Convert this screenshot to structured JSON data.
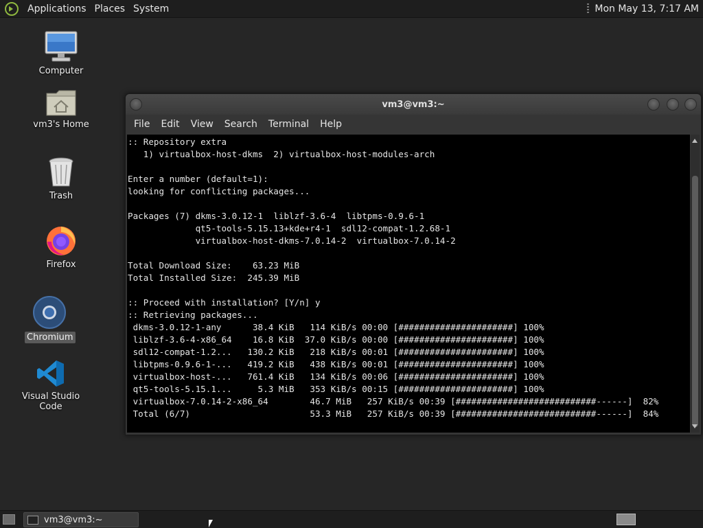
{
  "top_panel": {
    "menus": [
      "Applications",
      "Places",
      "System"
    ],
    "clock": "Mon May 13,  7:17 AM"
  },
  "desktop": {
    "icons": [
      {
        "label": "Computer",
        "icon": "computer-monitor-icon"
      },
      {
        "label": "vm3's Home",
        "icon": "home-folder-icon"
      },
      {
        "label": "Trash",
        "icon": "trash-icon"
      },
      {
        "label": "Firefox",
        "icon": "firefox-icon"
      },
      {
        "label": "Chromium",
        "icon": "chromium-icon",
        "selected": true
      },
      {
        "label": "Visual Studio Code",
        "icon": "vscode-icon"
      }
    ]
  },
  "window": {
    "title": "vm3@vm3:~",
    "menu": [
      "File",
      "Edit",
      "View",
      "Search",
      "Terminal",
      "Help"
    ],
    "terminal_lines": [
      ":: Repository extra",
      "   1) virtualbox-host-dkms  2) virtualbox-host-modules-arch",
      "",
      "Enter a number (default=1):",
      "looking for conflicting packages...",
      "",
      "Packages (7) dkms-3.0.12-1  liblzf-3.6-4  libtpms-0.9.6-1",
      "             qt5-tools-5.15.13+kde+r4-1  sdl12-compat-1.2.68-1",
      "             virtualbox-host-dkms-7.0.14-2  virtualbox-7.0.14-2",
      "",
      "Total Download Size:    63.23 MiB",
      "Total Installed Size:  245.39 MiB",
      "",
      ":: Proceed with installation? [Y/n] y",
      ":: Retrieving packages...",
      " dkms-3.0.12-1-any      38.4 KiB   114 KiB/s 00:00 [######################] 100%",
      " liblzf-3.6-4-x86_64    16.8 KiB  37.0 KiB/s 00:00 [######################] 100%",
      " sdl12-compat-1.2...   130.2 KiB   218 KiB/s 00:01 [######################] 100%",
      " libtpms-0.9.6-1-...   419.2 KiB   438 KiB/s 00:01 [######################] 100%",
      " virtualbox-host-...   761.4 KiB   134 KiB/s 00:06 [######################] 100%",
      " qt5-tools-5.15.1...     5.3 MiB   353 KiB/s 00:15 [######################] 100%",
      " virtualbox-7.0.14-2-x86_64        46.7 MiB   257 KiB/s 00:39 [###########################------]  82%",
      " Total (6/7)                       53.3 MiB   257 KiB/s 00:39 [###########################------]  84%"
    ]
  },
  "taskbar": {
    "tasks": [
      {
        "label": "vm3@vm3:~"
      }
    ]
  }
}
